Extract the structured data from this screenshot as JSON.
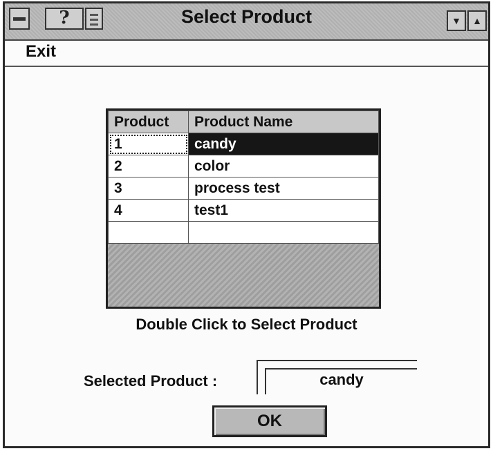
{
  "window": {
    "title": "Select Product",
    "help_glyph": "?",
    "min_glyph": "▼",
    "max_glyph": "▲"
  },
  "menu": {
    "exit_label": "Exit"
  },
  "grid": {
    "headers": [
      "Product",
      "Product Name"
    ],
    "rows": [
      {
        "id": "1",
        "name": "candy",
        "selected": true
      },
      {
        "id": "2",
        "name": "color"
      },
      {
        "id": "3",
        "name": "process test"
      },
      {
        "id": "4",
        "name": "test1"
      },
      {
        "id": "",
        "name": ""
      }
    ]
  },
  "hint": "Double Click to Select Product",
  "selected": {
    "label": "Selected Product :",
    "value": "candy"
  },
  "ok_label": "OK",
  "icons": [
    "system-menu-icon",
    "help-icon",
    "document-icon",
    "minimize-icon",
    "maximize-icon"
  ]
}
